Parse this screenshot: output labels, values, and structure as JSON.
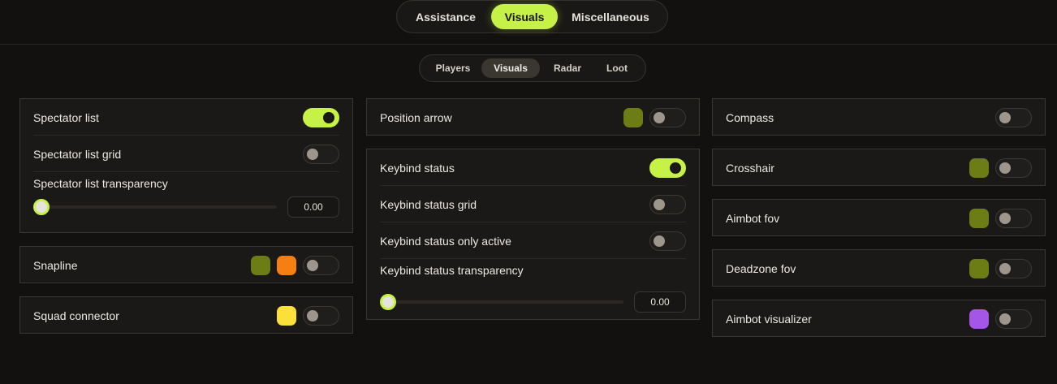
{
  "top_tabs": [
    {
      "label": "Assistance",
      "active": false
    },
    {
      "label": "Visuals",
      "active": true
    },
    {
      "label": "Miscellaneous",
      "active": false
    }
  ],
  "sub_tabs": [
    {
      "label": "Players",
      "active": false
    },
    {
      "label": "Visuals",
      "active": true
    },
    {
      "label": "Radar",
      "active": false
    },
    {
      "label": "Loot",
      "active": false
    }
  ],
  "colors": {
    "accent": "#c6f146",
    "olive": "#6b7d14",
    "orange": "#f77f11",
    "yellow": "#fbe03a",
    "purple": "#a356e8"
  },
  "left": {
    "spectator_list": {
      "label": "Spectator list",
      "enabled": true
    },
    "spectator_list_grid": {
      "label": "Spectator list grid",
      "enabled": false
    },
    "spectator_list_transparency": {
      "label": "Spectator list transparency",
      "value": "0.00"
    },
    "snapline": {
      "label": "Snapline",
      "enabled": false,
      "colors": [
        "#6b7d14",
        "#f77f11"
      ]
    },
    "squad_connector": {
      "label": "Squad connector",
      "enabled": false,
      "color": "#fbe03a"
    }
  },
  "middle": {
    "position_arrow": {
      "label": "Position arrow",
      "enabled": false,
      "color": "#6b7d14"
    },
    "keybind_status": {
      "label": "Keybind status",
      "enabled": true
    },
    "keybind_status_grid": {
      "label": "Keybind status grid",
      "enabled": false
    },
    "keybind_status_only_active": {
      "label": "Keybind status only active",
      "enabled": false
    },
    "keybind_status_transparency": {
      "label": "Keybind status transparency",
      "value": "0.00"
    }
  },
  "right": {
    "compass": {
      "label": "Compass",
      "enabled": false
    },
    "crosshair": {
      "label": "Crosshair",
      "enabled": false,
      "color": "#6b7d14"
    },
    "aimbot_fov": {
      "label": "Aimbot fov",
      "enabled": false,
      "color": "#6b7d14"
    },
    "deadzone_fov": {
      "label": "Deadzone fov",
      "enabled": false,
      "color": "#6b7d14"
    },
    "aimbot_visualizer": {
      "label": "Aimbot visualizer",
      "enabled": false,
      "color": "#a356e8"
    }
  }
}
